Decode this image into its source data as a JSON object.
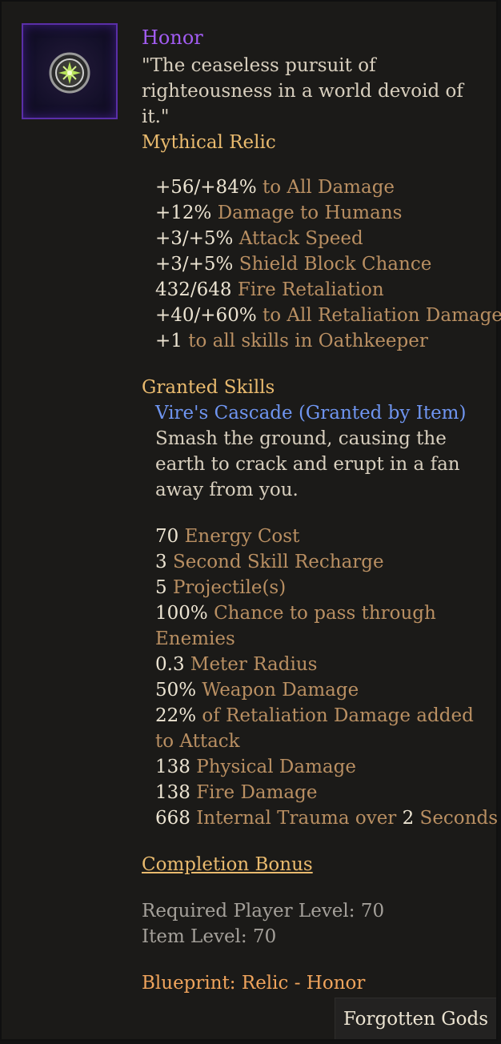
{
  "item": {
    "name": "Honor",
    "flavor": "\"The ceaseless pursuit of righteousness in a world devoid of it.\"",
    "rarity": "Mythical Relic",
    "icon": "relic-honor-icon",
    "accent_color": "#a25cf2"
  },
  "stats": [
    {
      "value": "+56/+84%",
      "label": " to All Damage"
    },
    {
      "value": "+12%",
      "label": " Damage to Humans"
    },
    {
      "value": "+3/+5%",
      "label": " Attack Speed"
    },
    {
      "value": "+3/+5%",
      "label": " Shield Block Chance"
    },
    {
      "value": "432/648",
      "label": " Fire Retaliation"
    },
    {
      "value": "+40/+60%",
      "label": " to All Retaliation Damage"
    },
    {
      "value": "+1",
      "label": " to all skills in Oathkeeper"
    }
  ],
  "granted_skills": {
    "title": "Granted Skills",
    "skill_name": "Vire's Cascade (Granted by Item)",
    "description": "Smash the ground, causing the earth to crack and erupt in a fan away from you.",
    "stats": [
      {
        "value": "70",
        "label": " Energy Cost"
      },
      {
        "value": "3",
        "label": " Second Skill Recharge"
      },
      {
        "value": "5",
        "label": " Projectile(s)"
      },
      {
        "value": "100%",
        "label": " Chance to pass through Enemies"
      },
      {
        "value": "0.3",
        "label": " Meter Radius"
      },
      {
        "value": "50%",
        "label": " Weapon Damage"
      },
      {
        "value": "22%",
        "label": " of Retaliation Damage added to Attack"
      },
      {
        "value": "138",
        "label": " Physical Damage"
      },
      {
        "value": "138",
        "label": " Fire Damage"
      },
      {
        "value": "668",
        "label": " Internal Trauma over ",
        "value2": "2",
        "label2": " Seconds"
      }
    ]
  },
  "completion_bonus": "Completion Bonus",
  "requirements": {
    "player_level": "Required Player Level: 70",
    "item_level": "Item Level: 70"
  },
  "blueprint": "Blueprint: Relic - Honor",
  "expansion": "Forgotten Gods"
}
